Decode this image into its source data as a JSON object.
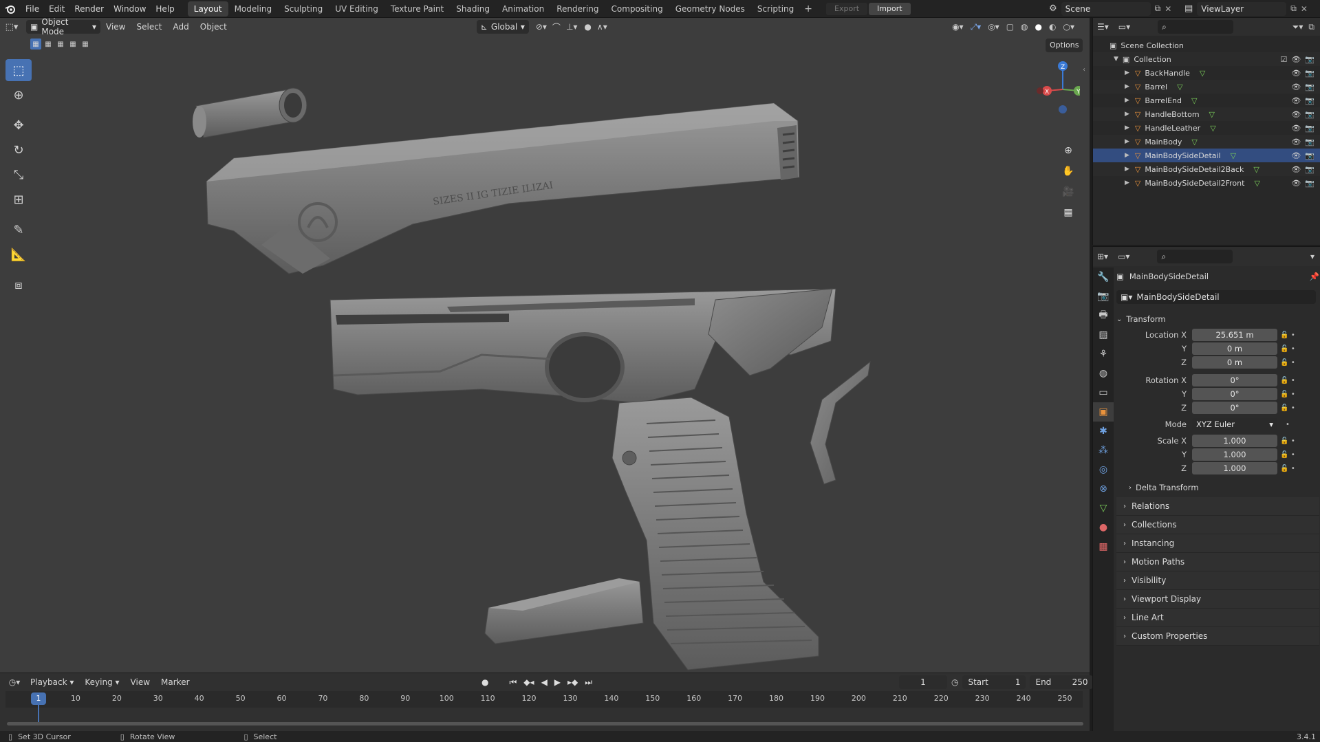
{
  "topbar": {
    "menus": [
      "File",
      "Edit",
      "Render",
      "Window",
      "Help"
    ],
    "workspaces": [
      "Layout",
      "Modeling",
      "Sculpting",
      "UV Editing",
      "Texture Paint",
      "Shading",
      "Animation",
      "Rendering",
      "Compositing",
      "Geometry Nodes",
      "Scripting"
    ],
    "active_workspace": "Layout",
    "add_label": "+",
    "export_label": "Export",
    "import_label": "Import",
    "scene_name": "Scene",
    "viewlayer_name": "ViewLayer"
  },
  "viewport": {
    "mode": "Object Mode",
    "menus": [
      "View",
      "Select",
      "Add",
      "Object"
    ],
    "orientation": "Global",
    "options_label": "Options",
    "engraving_text": "SIZES II IG TIZIE ILIZAI",
    "gizmo_axes": {
      "x": "X",
      "y": "Y",
      "z": "Z"
    }
  },
  "outliner": {
    "root": "Scene Collection",
    "collection": "Collection",
    "objects": [
      "BackHandle",
      "Barrel",
      "BarrelEnd",
      "HandleBottom",
      "HandleLeather",
      "MainBody",
      "MainBodySideDetail",
      "MainBodySideDetail2Back",
      "MainBodySideDetail2Front"
    ]
  },
  "properties": {
    "object_name": "MainBodySideDetail",
    "data_name": "MainBodySideDetail",
    "transform_title": "Transform",
    "location_label": "Location X",
    "location": [
      "25.651 m",
      "0 m",
      "0 m"
    ],
    "rotation_label": "Rotation X",
    "rotation": [
      "0°",
      "0°",
      "0°"
    ],
    "mode_label": "Mode",
    "mode_value": "XYZ Euler",
    "scale_label": "Scale X",
    "scale": [
      "1.000",
      "1.000",
      "1.000"
    ],
    "y_label": "Y",
    "z_label": "Z",
    "delta_label": "Delta Transform",
    "panels": [
      "Relations",
      "Collections",
      "Instancing",
      "Motion Paths",
      "Visibility",
      "Viewport Display",
      "Line Art",
      "Custom Properties"
    ]
  },
  "timeline": {
    "menus": [
      "Playback",
      "Keying",
      "View",
      "Marker"
    ],
    "current_frame": "1",
    "start_label": "Start",
    "start_value": "1",
    "end_label": "End",
    "end_value": "250",
    "ticks": [
      "1",
      "10",
      "20",
      "30",
      "40",
      "50",
      "60",
      "70",
      "80",
      "90",
      "100",
      "110",
      "120",
      "130",
      "140",
      "150",
      "160",
      "170",
      "180",
      "190",
      "200",
      "210",
      "220",
      "230",
      "240",
      "250"
    ]
  },
  "statusbar": {
    "hint1": "Set 3D Cursor",
    "hint2": "Rotate View",
    "hint3": "Select",
    "version": "3.4.1"
  },
  "colors": {
    "accent": "#4772b3",
    "viewport_bg": "#3d3d3d",
    "object_icon": "#e8923c",
    "mesh_icon": "#7bcf5a"
  }
}
